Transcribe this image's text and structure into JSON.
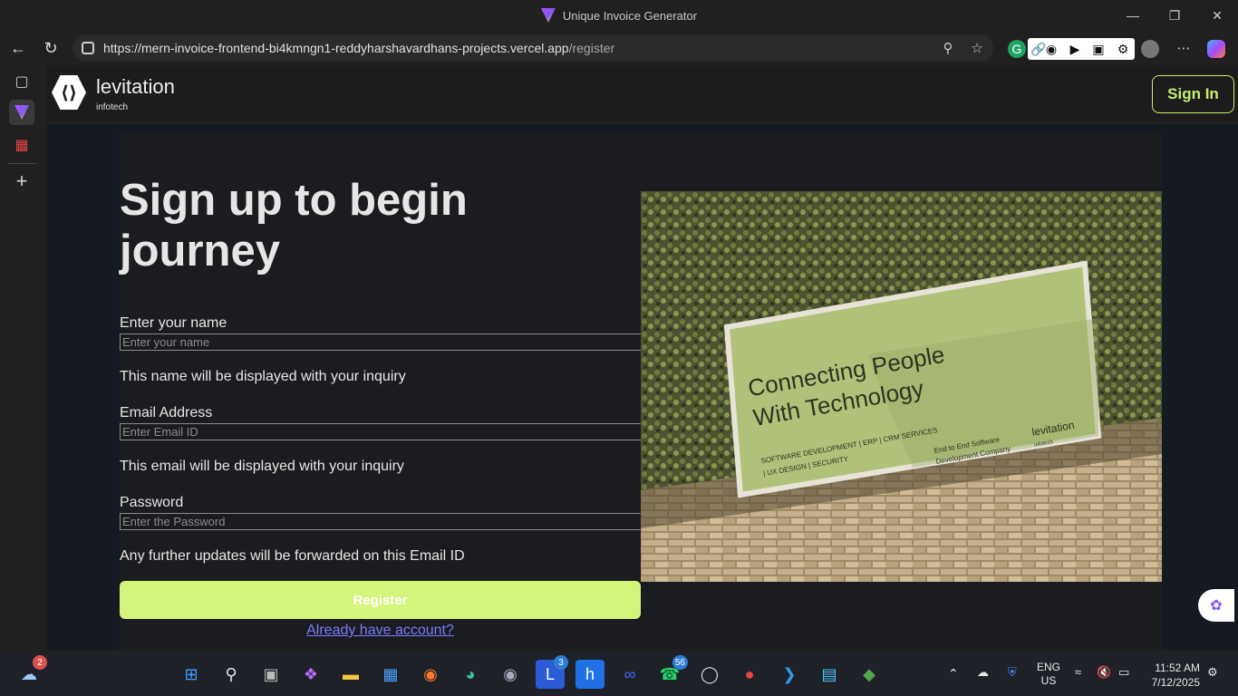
{
  "window": {
    "title": "Unique Invoice Generator"
  },
  "browser": {
    "url_host": "https://mern-invoice-frontend-bi4kmngn1-reddyharshavardhans-projects.vercel.app",
    "url_path": "/register"
  },
  "app": {
    "brand_name": "levitation",
    "brand_sub": "infotech",
    "signin_label": "Sign In"
  },
  "form": {
    "heading": "Sign up to begin journey",
    "name_label": "Enter your name",
    "name_placeholder": "Enter your name",
    "name_help": "This name will be displayed with your inquiry",
    "email_label": "Email Address",
    "email_placeholder": "Enter Email ID",
    "email_help": "This email will be displayed with your inquiry",
    "password_label": "Password",
    "password_placeholder": "Enter the Password",
    "password_help": "Any further updates will be forwarded on this Email ID",
    "register_label": "Register",
    "already_label": "Already have account?"
  },
  "photo": {
    "headline_line1": "Connecting People",
    "headline_line2": "With Technology",
    "services_line1": "SOFTWARE DEVELOPMENT | ERP | CRM SERVICES",
    "services_line2": "| UX DESIGN | SECURITY",
    "tagline_line1": "End to End Software",
    "tagline_line2": "Development Company",
    "logo_text": "levitation",
    "logo_sub": "infotech"
  },
  "taskbar": {
    "weather_badge": "2",
    "linear_badge": "3",
    "whatsapp_badge": "56",
    "lang_line1": "ENG",
    "lang_line2": "US",
    "time": "11:52 AM",
    "date": "7/12/2025"
  },
  "colors": {
    "accent": "#d4f57c",
    "signin": "#c8f06e",
    "link": "#7b7bff"
  }
}
